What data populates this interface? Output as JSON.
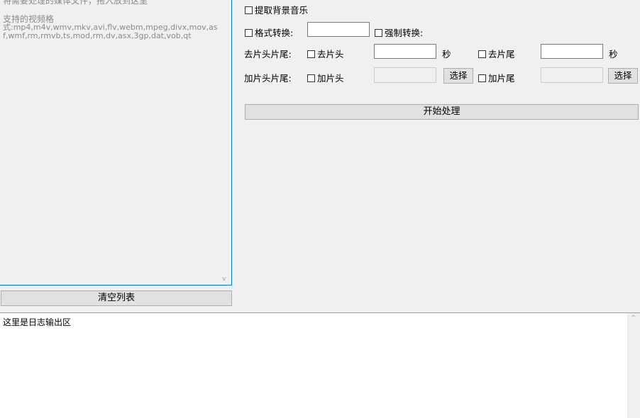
{
  "file_list": {
    "hint_top": "将需要处理的媒体文件，拖入放到这里",
    "hint_label": "支持的视频格",
    "hint_formats": "式:mp4,m4v,wmv,mkv,avi,flv,webm,mpeg,divx,mov,asf,wmf,rm,rmvb,ts,mod,rm,dv,asx,3gp,dat,vob,qt"
  },
  "clear_button": "清空列表",
  "log": {
    "text": "这里是日志输出区"
  },
  "options": {
    "extract_bg_music": "提取背景音乐",
    "format_convert": "格式转换:",
    "force_convert": "强制转换:",
    "trim_label": "去片头片尾:",
    "trim_head": "去片头",
    "trim_tail": "去片尾",
    "seconds_unit": "秒",
    "add_label": "加片头片尾:",
    "add_head": "加片头",
    "add_tail": "加片尾",
    "select_button": "选择",
    "start_button": "开始处理"
  },
  "inputs": {
    "format_value": "",
    "trim_head_seconds": "",
    "trim_tail_seconds": "",
    "add_head_path": "",
    "add_tail_path": ""
  }
}
